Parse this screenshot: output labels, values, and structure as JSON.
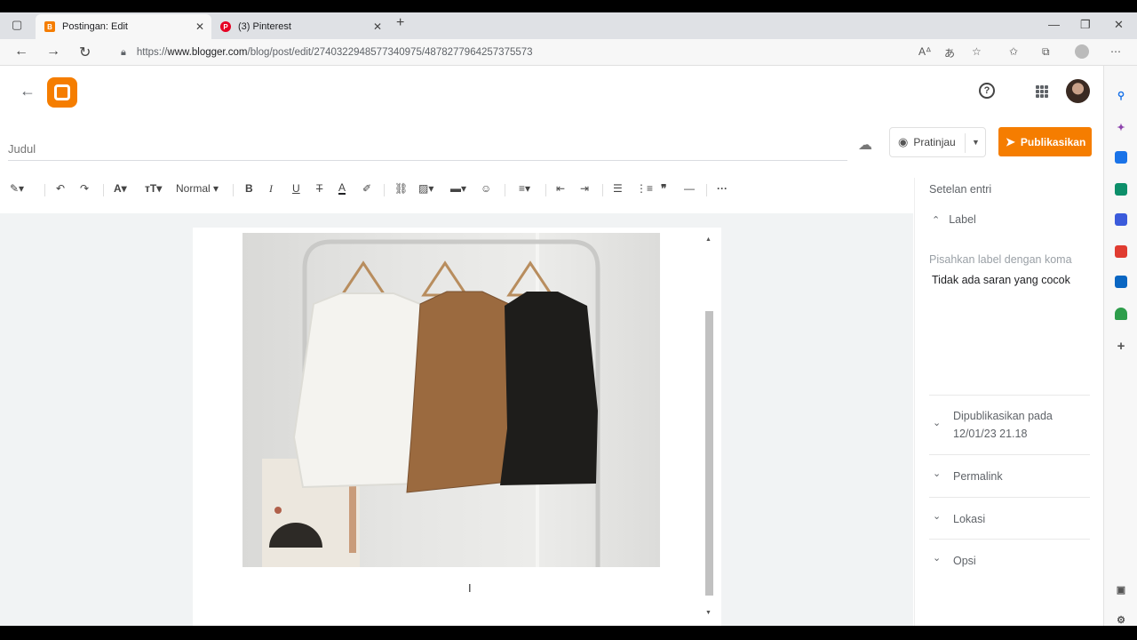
{
  "browser": {
    "tabs": [
      {
        "title": "Postingan: Edit",
        "active": true,
        "icon": "blogger-favicon-icon",
        "color": "#f57d00"
      },
      {
        "title": "(3) Pinterest",
        "active": false,
        "icon": "pinterest-favicon-icon",
        "color": "#e60023"
      }
    ],
    "url_prefix": "https://",
    "url_host": "www.blogger.com",
    "url_path": "/blog/post/edit/2740322948577340975/4878277964257375573"
  },
  "header": {
    "help_glyph": "?"
  },
  "editor": {
    "title_placeholder": "Judul",
    "preview_label": "Pratinjau",
    "publish_label": "Publikasikan",
    "paragraph_style": "Normal",
    "accent_color": "#f57d00"
  },
  "panel": {
    "heading": "Setelan entri",
    "label_section": "Label",
    "label_placeholder": "Pisahkan label dengan koma",
    "no_suggestions": "Tidak ada saran yang cocok",
    "published_label": "Dipublikasikan pada",
    "published_date": "12/01/23 21.18",
    "permalink": "Permalink",
    "location": "Lokasi",
    "options": "Opsi"
  }
}
